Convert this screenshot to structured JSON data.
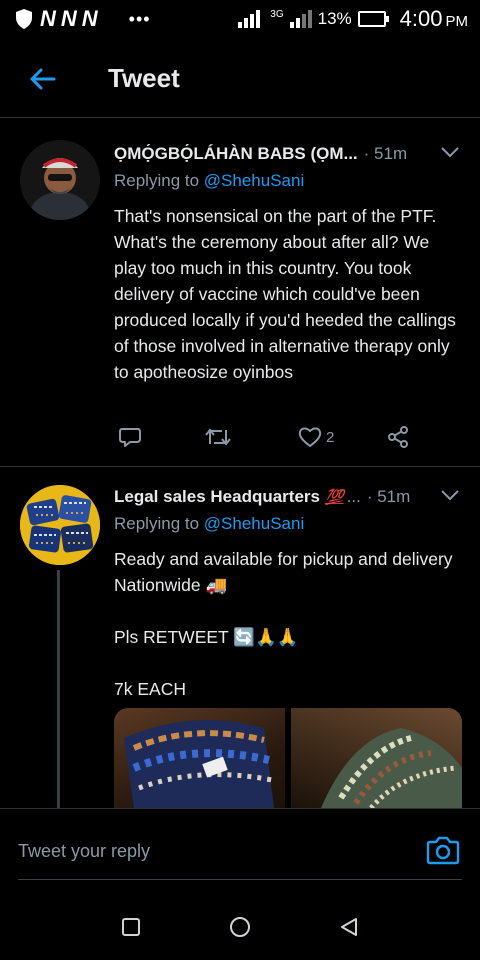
{
  "status_bar": {
    "network_letters": [
      "N",
      "N",
      "N"
    ],
    "dots": "•••",
    "network_type": "3G",
    "battery": "13%",
    "time": "4:00",
    "ampm": "PM"
  },
  "header": {
    "title": "Tweet"
  },
  "tweets": [
    {
      "name": "ỌMỌ́GBỌ́LÁHÀN BABS (ỌM...",
      "time": "· 51m",
      "replying_prefix": "Replying to ",
      "replying_handle": "@ShehuSani",
      "text": "That's nonsensical on the part of the PTF. What's the ceremony about after all? We play too much in this country. You took delivery of vaccine which could've been produced locally if you'd heeded the callings of those involved in alternative therapy only to apotheosize oyinbos",
      "like_count": "2"
    },
    {
      "name": "Legal sales Headquarters",
      "name_emoji": "💯",
      "ellipsis": "...",
      "time": "· 51m",
      "replying_prefix": "Replying to ",
      "replying_handle": "@ShehuSani",
      "text_line1": "Ready and available for pickup and delivery Nationwide 🚚",
      "text_line2": "Pls RETWEET 🔄🙏🙏",
      "text_line3": "7k EACH"
    }
  ],
  "reply_bar": {
    "placeholder": "Tweet your reply"
  },
  "colors": {
    "accent": "#1d9bf0",
    "muted": "#8b98a5",
    "text": "#e7e9ea",
    "background": "#000000"
  }
}
